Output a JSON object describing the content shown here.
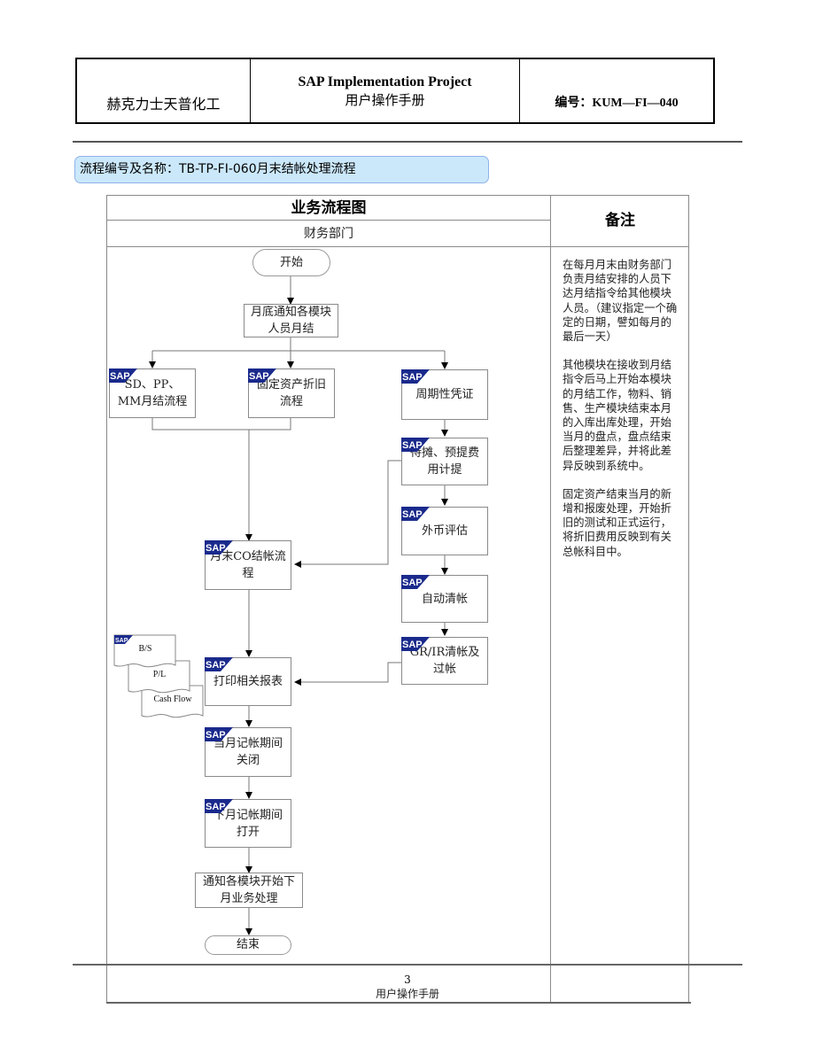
{
  "header": {
    "company": "赫克力士天普化工",
    "project_en": "SAP Implementation Project",
    "project_cn": "用户操作手册",
    "doc_number": "编号：KUM—FI—040"
  },
  "process_title": "流程编号及名称：TB-TP-FI-060月末结帐处理流程",
  "table": {
    "flow_header": "业务流程图",
    "department": "财务部门",
    "notes_header": "备注"
  },
  "notes": [
    "在每月月末由财务部门负责月结安排的人员下达月结指令给其他模块人员。（建议指定一个确定的日期，譬如每月的最后一天）",
    "其他模块在接收到月结指令后马上开始本模块的月结工作，物料、销售、生产模块结束本月的入库出库处理，开始当月的盘点，盘点结束后整理差异，并将此差异反映到系统中。",
    "固定资产结束当月的新增和报废处理，开始折旧的测试和正式运行，将折旧费用反映到有关总帐科目中。"
  ],
  "flow": {
    "start": "开始",
    "notify": "月底通知各模块人员月结",
    "sd_pp_mm": "SD、PP、MM月结流程",
    "fixed_asset": "固定资产折旧流程",
    "periodic": "周期性凭证",
    "accrual": "待摊、预提费用计提",
    "fx": "外币评估",
    "auto_clear": "自动清帐",
    "grir": "GR/IR清帐及过帐",
    "co_close": "月末CO结帐流程",
    "print_reports": "打印相关报表",
    "close_period": "当月记帐期间关闭",
    "open_period": "下月记帐期间打开",
    "notify_next": "通知各模块开始下月业务处理",
    "end": "结束",
    "sap_badge": "SAP"
  },
  "reports": [
    "B/S",
    "P/L",
    "Cash Flow"
  ],
  "footer": {
    "page_number": "3",
    "doc_name": "用户操作手册"
  },
  "colors": {
    "banner_bg": "#cbe8fb",
    "banner_border": "#8fb2e8",
    "sap_blue": "#1a2a8c"
  }
}
